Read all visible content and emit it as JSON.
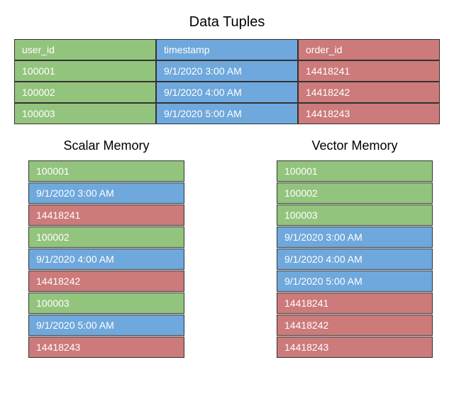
{
  "titles": {
    "tuples": "Data Tuples",
    "scalar": "Scalar Memory",
    "vector": "Vector Memory"
  },
  "tuples": {
    "headers": {
      "user_id": "user_id",
      "timestamp": "timestamp",
      "order_id": "order_id"
    },
    "rows": [
      {
        "user_id": "100001",
        "timestamp": "9/1/2020 3:00 AM",
        "order_id": "14418241"
      },
      {
        "user_id": "100002",
        "timestamp": "9/1/2020 4:00 AM",
        "order_id": "14418242"
      },
      {
        "user_id": "100003",
        "timestamp": "9/1/2020 5:00 AM",
        "order_id": "14418243"
      }
    ]
  },
  "scalar_memory": [
    {
      "value": "100001",
      "class": "green"
    },
    {
      "value": "9/1/2020 3:00 AM",
      "class": "blue"
    },
    {
      "value": "14418241",
      "class": "red"
    },
    {
      "value": "100002",
      "class": "green"
    },
    {
      "value": "9/1/2020 4:00 AM",
      "class": "blue"
    },
    {
      "value": "14418242",
      "class": "red"
    },
    {
      "value": "100003",
      "class": "green"
    },
    {
      "value": "9/1/2020 5:00 AM",
      "class": "blue"
    },
    {
      "value": "14418243",
      "class": "red"
    }
  ],
  "vector_memory": [
    {
      "value": "100001",
      "class": "green"
    },
    {
      "value": "100002",
      "class": "green"
    },
    {
      "value": "100003",
      "class": "green"
    },
    {
      "value": "9/1/2020 3:00 AM",
      "class": "blue"
    },
    {
      "value": "9/1/2020 4:00 AM",
      "class": "blue"
    },
    {
      "value": "9/1/2020 5:00 AM",
      "class": "blue"
    },
    {
      "value": "14418241",
      "class": "red"
    },
    {
      "value": "14418242",
      "class": "red"
    },
    {
      "value": "14418243",
      "class": "red"
    }
  ],
  "chart_data": {
    "type": "table",
    "title": "Data Tuples",
    "columns": [
      "user_id",
      "timestamp",
      "order_id"
    ],
    "rows": [
      [
        "100001",
        "9/1/2020 3:00 AM",
        "14418241"
      ],
      [
        "100002",
        "9/1/2020 4:00 AM",
        "14418242"
      ],
      [
        "100003",
        "9/1/2020 5:00 AM",
        "14418243"
      ]
    ]
  }
}
